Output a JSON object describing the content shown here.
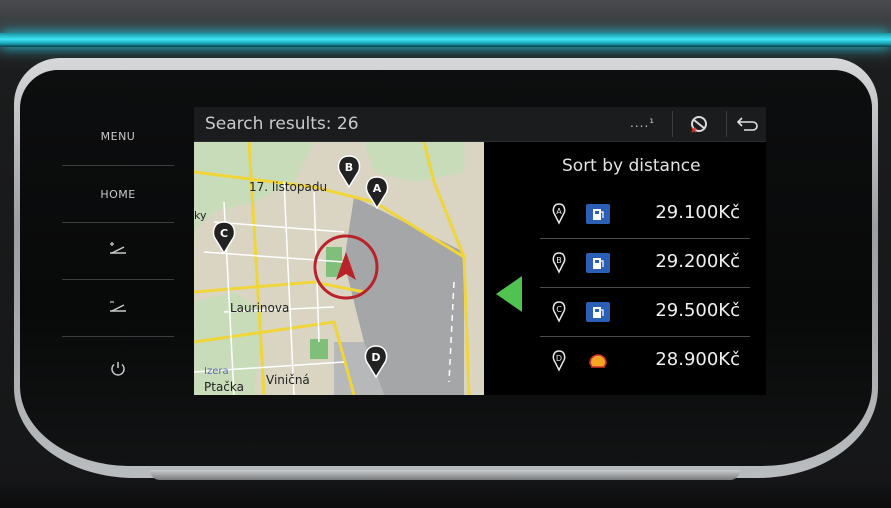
{
  "hardware_buttons": {
    "menu_label": "MENU",
    "home_label": "HOME",
    "brightness_up_icon": "brightness-up-icon",
    "brightness_down_icon": "brightness-down-icon",
    "power_icon": "power-icon"
  },
  "header": {
    "title": "Search results: 26",
    "signal": "....¹",
    "icons": [
      "mute-icon",
      "back-icon"
    ]
  },
  "map": {
    "street_labels": [
      "17. listopadu",
      "Laurinova",
      "Viničná",
      "Izera",
      "Ptačka",
      "ky"
    ],
    "markers": [
      "A",
      "B",
      "C",
      "D"
    ]
  },
  "results": {
    "sort_label": "Sort by distance",
    "items": [
      {
        "marker": "A",
        "icon": "fuel-pump-icon",
        "price": "29.100Kč"
      },
      {
        "marker": "B",
        "icon": "fuel-pump-icon",
        "price": "29.200Kč"
      },
      {
        "marker": "C",
        "icon": "fuel-pump-icon",
        "price": "29.500Kč"
      },
      {
        "marker": "D",
        "icon": "shell-icon",
        "price": "28.900Kč"
      }
    ]
  },
  "colors": {
    "ambient": "#3fe6f6",
    "accent_green": "#4fc24f",
    "compass_red": "#b8232a",
    "fuel_blue": "#2a5fb3",
    "shell_orange": "#f5a623"
  }
}
